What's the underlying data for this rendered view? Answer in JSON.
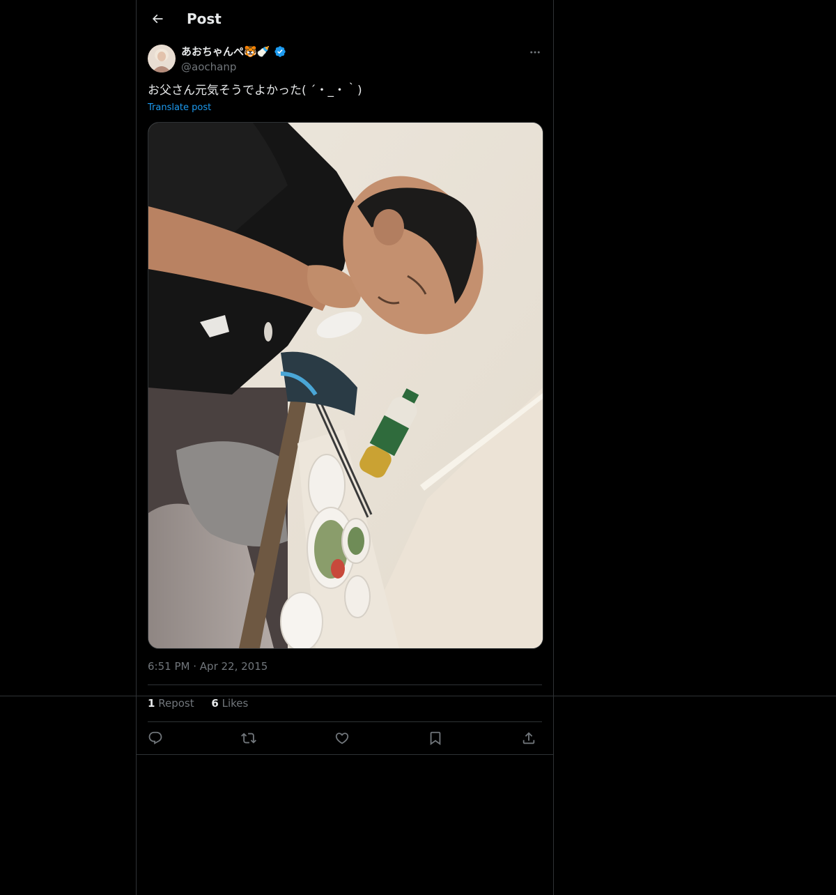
{
  "header": {
    "title": "Post"
  },
  "author": {
    "display_name": "あおちゃんぺ🐯🍼",
    "handle": "@aochanp",
    "verified": true
  },
  "tweet": {
    "text": "お父さん元気そうでよかった( ´・_・｀)",
    "translate_label": "Translate post",
    "time": "6:51 PM",
    "separator": "·",
    "date": "Apr 22, 2015"
  },
  "stats": {
    "reposts_count": "1",
    "reposts_label": "Repost",
    "likes_count": "6",
    "likes_label": "Likes"
  },
  "icons": {
    "back": "arrow-left-icon",
    "more": "more-horizontal-icon",
    "verified": "verified-badge-icon",
    "reply": "reply-icon",
    "repost": "repost-icon",
    "like": "heart-icon",
    "bookmark": "bookmark-icon",
    "share": "share-icon"
  },
  "colors": {
    "background": "#000000",
    "text": "#e7e9ea",
    "muted": "#71767b",
    "accent": "#1d9bf0",
    "border": "#2f3336"
  }
}
